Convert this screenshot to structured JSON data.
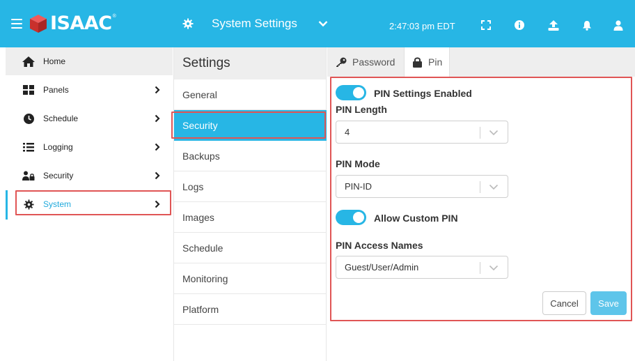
{
  "header": {
    "brand": "ISAAC",
    "brand_mark": "®",
    "app_title": "System Settings",
    "clock": "2:47:03 pm EDT",
    "colors": {
      "bar": "#27b6e5",
      "brand_red": "#d63b3b"
    },
    "icons": [
      "menu-icon",
      "gear-icon",
      "chevron-down-icon",
      "fullscreen-icon",
      "info-icon",
      "upload-icon",
      "bell-icon",
      "user-icon"
    ]
  },
  "sidebar": {
    "items": [
      {
        "label": "Home",
        "icon": "home-icon"
      },
      {
        "label": "Panels",
        "icon": "panels-icon"
      },
      {
        "label": "Schedule",
        "icon": "clock-icon"
      },
      {
        "label": "Logging",
        "icon": "list-icon"
      },
      {
        "label": "Security",
        "icon": "users-lock-icon"
      },
      {
        "label": "System",
        "icon": "gear-icon",
        "active": true
      }
    ]
  },
  "settings": {
    "title": "Settings",
    "items": [
      "General",
      "Security",
      "Backups",
      "Logs",
      "Images",
      "Schedule",
      "Monitoring",
      "Platform"
    ],
    "active": "Security"
  },
  "tabs": [
    {
      "label": "Password",
      "icon": "key-icon"
    },
    {
      "label": "Pin",
      "icon": "lock-icon",
      "active": true
    }
  ],
  "pin": {
    "enabled_label": "PIN Settings Enabled",
    "enabled": true,
    "length_label": "PIN Length",
    "length_value": "4",
    "mode_label": "PIN Mode",
    "mode_value": "PIN-ID",
    "custom_label": "Allow Custom PIN",
    "custom_enabled": true,
    "access_label": "PIN Access Names",
    "access_value": "Guest/User/Admin"
  },
  "actions": {
    "cancel": "Cancel",
    "save": "Save"
  }
}
